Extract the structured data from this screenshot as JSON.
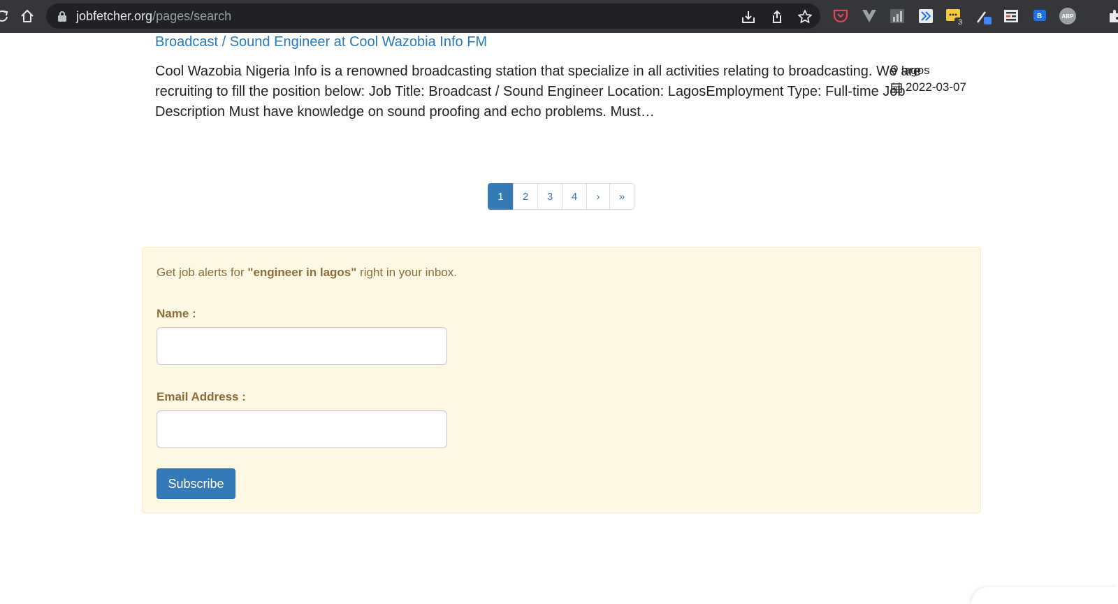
{
  "browser": {
    "url_domain": "jobfetcher.org",
    "url_path": "/pages/search",
    "extension_badge_count": "3",
    "abp_label": "ABP"
  },
  "job": {
    "title": "Broadcast / Sound Engineer at Cool Wazobia Info FM",
    "description": "Cool Wazobia Nigeria Info is a renowned broadcasting station that specialize in all activities relating to broadcasting. We are recruiting to fill the position below: Job Title: Broadcast / Sound Engineer Location: LagosEmployment Type: Full-time Job Description Must have knowledge on sound proofing and echo problems. Must…",
    "location": "lagos",
    "date": "2022-03-07"
  },
  "pagination": {
    "items": [
      "1",
      "2",
      "3",
      "4",
      "›",
      "»"
    ],
    "active": "1"
  },
  "alert": {
    "prefix": "Get job alerts for ",
    "query": "\"engineer in lagos\"",
    "suffix": " right in your inbox.",
    "name_label": "Name :",
    "name_value": "",
    "email_label": "Email Address :",
    "email_value": "",
    "subscribe_label": "Subscribe"
  },
  "colors": {
    "link": "#2a7ab8",
    "primary": "#337ab7",
    "alert_bg": "#fcf8e3",
    "alert_text": "#8a6d3b",
    "chrome_bg": "#35363a"
  }
}
